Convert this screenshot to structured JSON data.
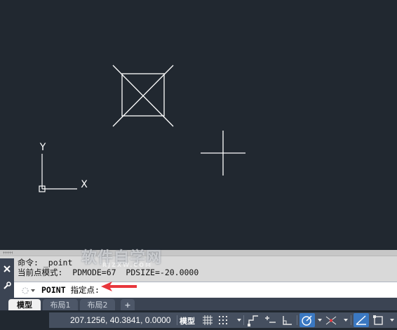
{
  "command_line": {
    "history": [
      "命令: _point",
      "当前点模式:  PDMODE=67  PDSIZE=-20.0000"
    ],
    "prompt_command": "POINT",
    "prompt_text": "指定点:"
  },
  "watermark": {
    "main": "软件自学网",
    "sub": "RJZXW.COM"
  },
  "layout_tabs": [
    {
      "label": "模型",
      "active": true
    },
    {
      "label": "布局1",
      "active": false
    },
    {
      "label": "布局2",
      "active": false
    }
  ],
  "add_tab_label": "+",
  "status_bar": {
    "coordinates": "207.1256, 40.3841, 0.0000",
    "space_label": "模型"
  },
  "ucs": {
    "x_label": "X",
    "y_label": "Y"
  },
  "colors": {
    "canvas_bg": "#212830",
    "geometry": "#ffffff",
    "arrow": "#e8363c",
    "status_active": "#3a78c2"
  }
}
